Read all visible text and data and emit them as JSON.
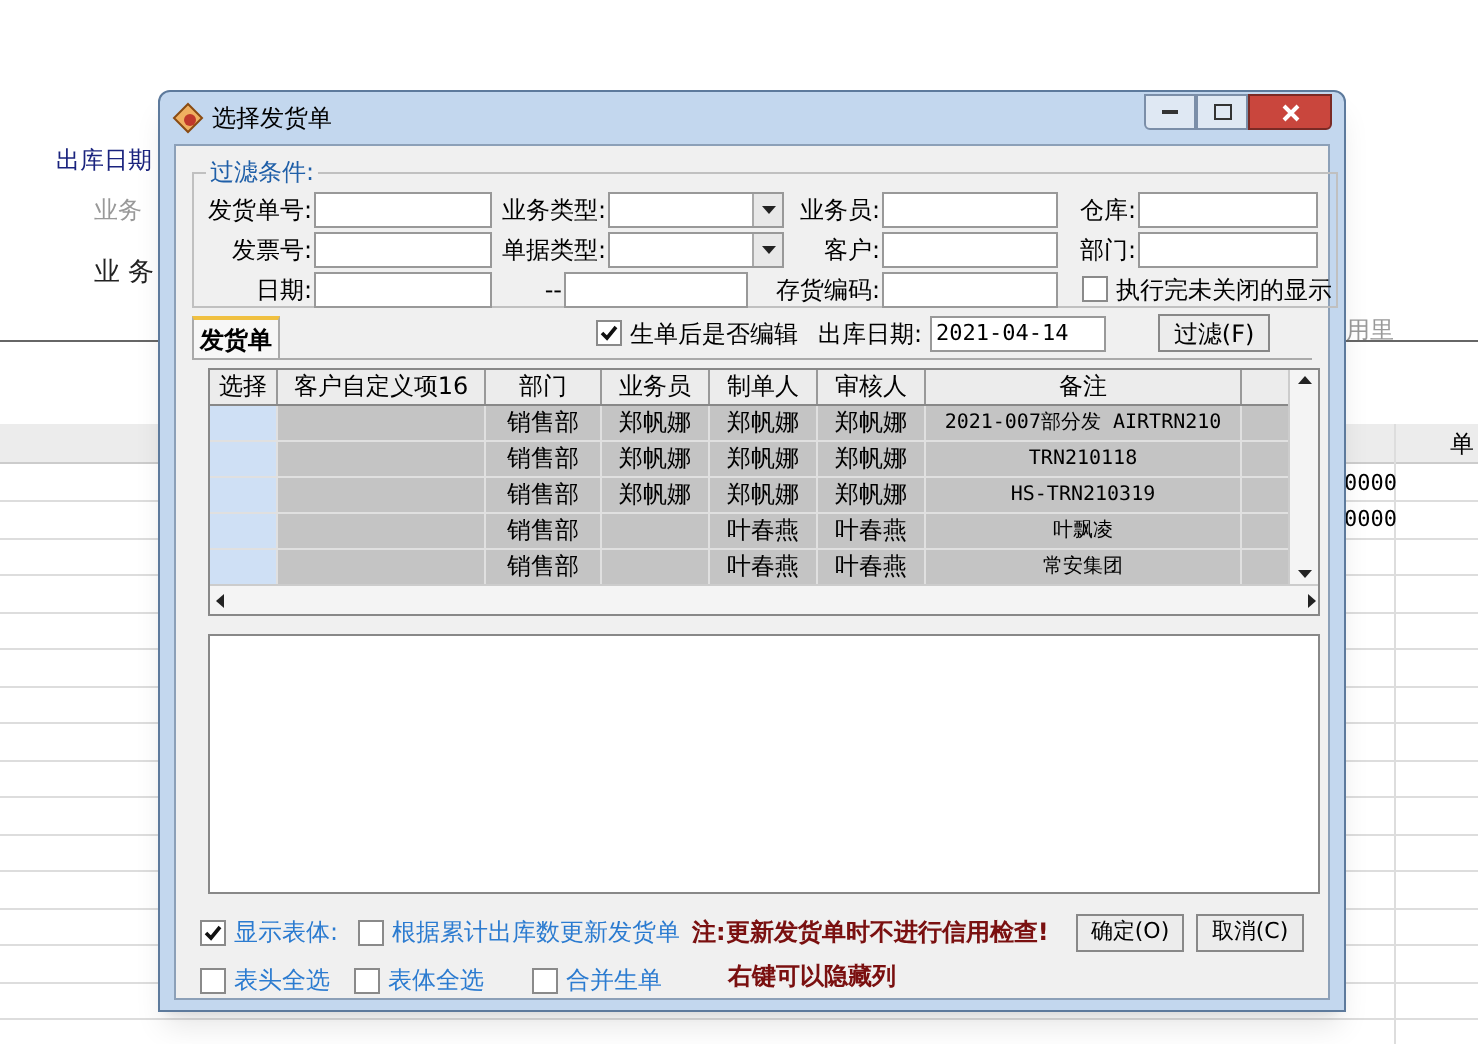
{
  "background": {
    "labels": [
      {
        "kind": "heading",
        "text": "出库日期"
      },
      {
        "kind": "muted",
        "text": "业务"
      },
      {
        "kind": "plain",
        "text": "业 务"
      },
      {
        "kind": "usage",
        "text": "用里"
      }
    ],
    "columns": [
      "单"
    ],
    "values": [
      "0000",
      "0000"
    ]
  },
  "dialog": {
    "title": "选择发货单",
    "filter": {
      "legend": "过滤条件:",
      "rows": [
        [
          {
            "kind": "text",
            "label": "发货单号:"
          },
          {
            "kind": "dropdown",
            "label": "业务类型:"
          },
          {
            "kind": "text",
            "label": "业务员:"
          },
          {
            "kind": "text",
            "label": "仓库:"
          }
        ],
        [
          {
            "kind": "text",
            "label": "发票号:"
          },
          {
            "kind": "dropdown",
            "label": "单据类型:"
          },
          {
            "kind": "text",
            "label": "客户:"
          },
          {
            "kind": "text",
            "label": "部门:"
          }
        ],
        [
          {
            "kind": "text",
            "label": "日期:"
          },
          {
            "kind": "text",
            "label": "--"
          },
          {
            "kind": "text",
            "label": "存货编码:"
          },
          {
            "kind": "checkbox",
            "label": "执行完未关闭的显示",
            "checked": false
          }
        ]
      ]
    },
    "tabs": [
      {
        "label": "发货单",
        "selected": true
      }
    ],
    "edit_after": {
      "label": "生单后是否编辑",
      "checked": true
    },
    "date": {
      "label": "出库日期:",
      "value": "2021-04-14"
    },
    "filter_button": "过滤(F)",
    "table": {
      "columns": [
        "选择",
        "客户自定义项16",
        "部门",
        "业务员",
        "制单人",
        "审核人",
        "备注"
      ],
      "rows": [
        {
          "cells": [
            "",
            "",
            "销售部",
            "郑帆娜",
            "郑帆娜",
            "郑帆娜",
            "2021-007部分发 AIRTRN210"
          ]
        },
        {
          "cells": [
            "",
            "",
            "销售部",
            "郑帆娜",
            "郑帆娜",
            "郑帆娜",
            "TRN210118"
          ]
        },
        {
          "cells": [
            "",
            "",
            "销售部",
            "郑帆娜",
            "郑帆娜",
            "郑帆娜",
            "HS-TRN210319"
          ]
        },
        {
          "cells": [
            "",
            "",
            "销售部",
            "",
            "叶春燕",
            "叶春燕",
            "叶飘凌"
          ]
        },
        {
          "cells": [
            "",
            "",
            "销售部",
            "",
            "叶春燕",
            "叶春燕",
            "常安集团"
          ]
        }
      ]
    },
    "options": [
      {
        "label": "显示表体:",
        "checked": true
      },
      {
        "label": "根据累计出库数更新发货单",
        "checked": false
      },
      {
        "label": "表头全选",
        "checked": false
      },
      {
        "label": "表体全选",
        "checked": false
      },
      {
        "label": "合并生单",
        "checked": false
      }
    ],
    "notes": [
      "注:更新发货单时不进行信用检查!",
      "右键可以隐藏列"
    ],
    "buttons": [
      "确定(O)",
      "取消(C)"
    ]
  }
}
